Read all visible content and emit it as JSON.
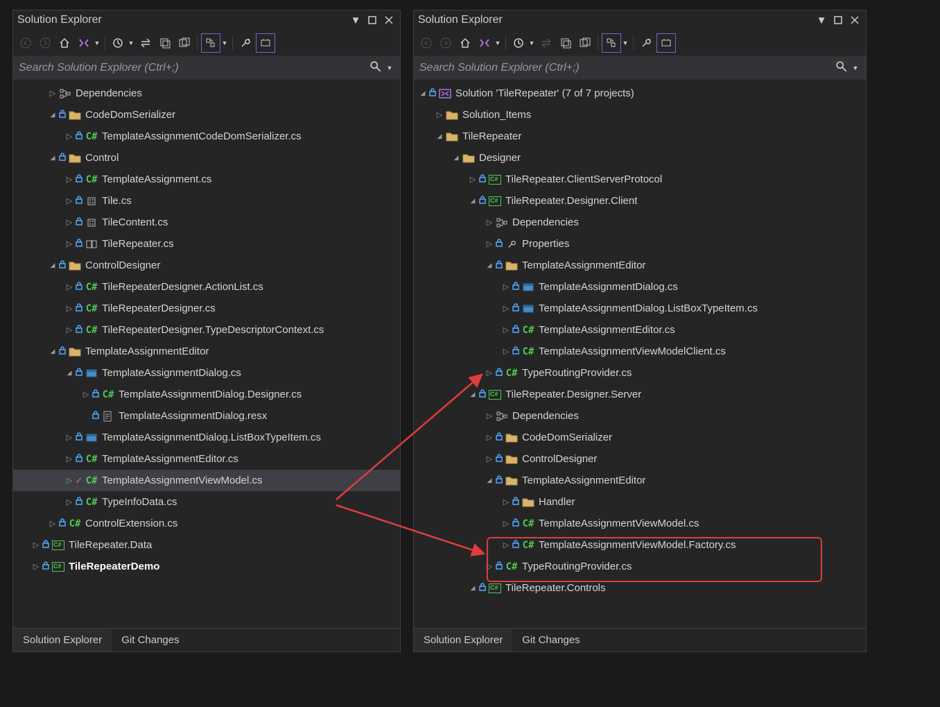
{
  "panel_title": "Solution Explorer",
  "search_placeholder": "Search Solution Explorer (Ctrl+;)",
  "bottom_tabs": {
    "active": "Solution Explorer",
    "inactive": "Git Changes"
  },
  "left_tree": [
    {
      "d": 1,
      "c": "r",
      "k": "dep",
      "t": "Dependencies"
    },
    {
      "d": 1,
      "c": "d",
      "k": "folder",
      "lock": true,
      "t": "CodeDomSerializer"
    },
    {
      "d": 2,
      "c": "r",
      "k": "cs",
      "lock": true,
      "t": "TemplateAssignmentCodeDomSerializer.cs"
    },
    {
      "d": 1,
      "c": "d",
      "k": "folder",
      "lock": true,
      "t": "Control"
    },
    {
      "d": 2,
      "c": "r",
      "k": "cs",
      "lock": true,
      "t": "TemplateAssignment.cs"
    },
    {
      "d": 2,
      "c": "r",
      "k": "comp",
      "lock": true,
      "t": "Tile.cs"
    },
    {
      "d": 2,
      "c": "r",
      "k": "comp",
      "lock": true,
      "t": "TileContent.cs"
    },
    {
      "d": 2,
      "c": "r",
      "k": "comp2",
      "lock": true,
      "t": "TileRepeater.cs"
    },
    {
      "d": 1,
      "c": "d",
      "k": "folder",
      "lock": true,
      "t": "ControlDesigner"
    },
    {
      "d": 2,
      "c": "r",
      "k": "cs",
      "lock": true,
      "t": "TileRepeaterDesigner.ActionList.cs"
    },
    {
      "d": 2,
      "c": "r",
      "k": "cs",
      "lock": true,
      "t": "TileRepeaterDesigner.cs"
    },
    {
      "d": 2,
      "c": "r",
      "k": "cs",
      "lock": true,
      "t": "TileRepeaterDesigner.TypeDescriptorContext.cs"
    },
    {
      "d": 1,
      "c": "d",
      "k": "folder",
      "lock": true,
      "t": "TemplateAssignmentEditor"
    },
    {
      "d": 2,
      "c": "d",
      "k": "form",
      "lock": true,
      "t": "TemplateAssignmentDialog.cs"
    },
    {
      "d": 3,
      "c": "r",
      "k": "cs",
      "lock": true,
      "t": "TemplateAssignmentDialog.Designer.cs"
    },
    {
      "d": 3,
      "c": "",
      "k": "resx",
      "lock": true,
      "t": "TemplateAssignmentDialog.resx"
    },
    {
      "d": 2,
      "c": "r",
      "k": "form",
      "lock": true,
      "t": "TemplateAssignmentDialog.ListBoxTypeItem.cs"
    },
    {
      "d": 2,
      "c": "r",
      "k": "cs",
      "lock": true,
      "t": "TemplateAssignmentEditor.cs"
    },
    {
      "d": 2,
      "c": "r",
      "k": "cs",
      "check": true,
      "t": "TemplateAssignmentViewModel.cs",
      "sel": true
    },
    {
      "d": 2,
      "c": "r",
      "k": "cs",
      "lock": true,
      "t": "TypeInfoData.cs"
    },
    {
      "d": 1,
      "c": "r",
      "k": "cs",
      "lock": true,
      "t": "ControlExtension.cs"
    },
    {
      "d": 0,
      "c": "r",
      "k": "proj",
      "lock": true,
      "t": "TileRepeater.Data"
    },
    {
      "d": 0,
      "c": "r",
      "k": "proj",
      "lock": true,
      "t": "TileRepeaterDemo",
      "bold": true
    }
  ],
  "right_tree": [
    {
      "d": 0,
      "c": "d",
      "k": "sln",
      "lock": true,
      "t": "Solution 'TileRepeater' (7 of 7 projects)"
    },
    {
      "d": 1,
      "c": "r",
      "k": "folder",
      "t": "Solution_Items"
    },
    {
      "d": 1,
      "c": "d",
      "k": "folder",
      "t": "TileRepeater"
    },
    {
      "d": 2,
      "c": "d",
      "k": "folder",
      "t": "Designer"
    },
    {
      "d": 3,
      "c": "r",
      "k": "proj",
      "lock": true,
      "t": "TileRepeater.ClientServerProtocol"
    },
    {
      "d": 3,
      "c": "d",
      "k": "proj",
      "lock": true,
      "t": "TileRepeater.Designer.Client"
    },
    {
      "d": 4,
      "c": "r",
      "k": "dep",
      "t": "Dependencies"
    },
    {
      "d": 4,
      "c": "r",
      "k": "wrench",
      "lock": true,
      "t": "Properties"
    },
    {
      "d": 4,
      "c": "d",
      "k": "folder",
      "lock": true,
      "t": "TemplateAssignmentEditor"
    },
    {
      "d": 5,
      "c": "r",
      "k": "form",
      "lock": true,
      "t": "TemplateAssignmentDialog.cs"
    },
    {
      "d": 5,
      "c": "r",
      "k": "form",
      "lock": true,
      "t": "TemplateAssignmentDialog.ListBoxTypeItem.cs"
    },
    {
      "d": 5,
      "c": "r",
      "k": "cs",
      "lock": true,
      "t": "TemplateAssignmentEditor.cs"
    },
    {
      "d": 5,
      "c": "r",
      "k": "cs",
      "lock": true,
      "t": "TemplateAssignmentViewModelClient.cs"
    },
    {
      "d": 4,
      "c": "r",
      "k": "cs",
      "lock": true,
      "t": "TypeRoutingProvider.cs"
    },
    {
      "d": 3,
      "c": "d",
      "k": "proj",
      "lock": true,
      "t": "TileRepeater.Designer.Server"
    },
    {
      "d": 4,
      "c": "r",
      "k": "dep",
      "t": "Dependencies"
    },
    {
      "d": 4,
      "c": "r",
      "k": "folder",
      "lock": true,
      "t": "CodeDomSerializer"
    },
    {
      "d": 4,
      "c": "r",
      "k": "folder",
      "lock": true,
      "t": "ControlDesigner"
    },
    {
      "d": 4,
      "c": "d",
      "k": "folder",
      "lock": true,
      "t": "TemplateAssignmentEditor"
    },
    {
      "d": 5,
      "c": "r",
      "k": "folder",
      "lock": true,
      "t": "Handler"
    },
    {
      "d": 5,
      "c": "r",
      "k": "cs",
      "lock": true,
      "t": "TemplateAssignmentViewModel.cs"
    },
    {
      "d": 5,
      "c": "r",
      "k": "cs",
      "lock": true,
      "t": "TemplateAssignmentViewModel.Factory.cs"
    },
    {
      "d": 4,
      "c": "r",
      "k": "cs",
      "lock": true,
      "t": "TypeRoutingProvider.cs"
    },
    {
      "d": 3,
      "c": "d",
      "k": "proj",
      "lock": true,
      "t": "TileRepeater.Controls"
    }
  ]
}
